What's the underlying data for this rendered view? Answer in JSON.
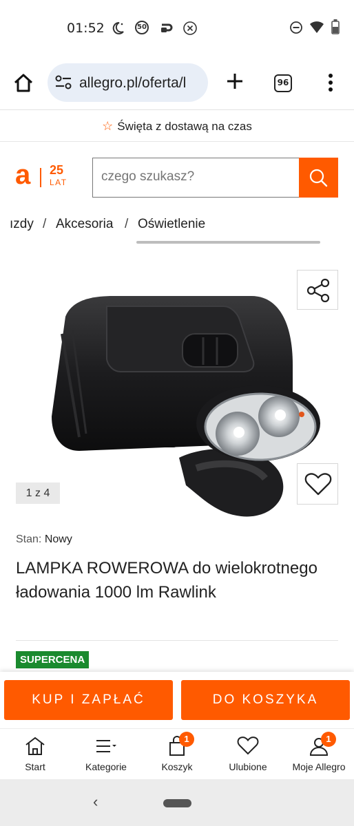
{
  "status_bar": {
    "time": "01:52",
    "icons": [
      "moon-alarm-icon",
      "speed-50-icon",
      "sync-icon",
      "close-circle-icon",
      "dnd-icon",
      "wifi-icon",
      "battery-icon"
    ],
    "speed_label": "50"
  },
  "browser": {
    "url": "allegro.pl/oferta/l",
    "tab_count": "96"
  },
  "promo": {
    "text": "Święta z dostawą na czas"
  },
  "logo": {
    "letter": "a",
    "years": "25",
    "suffix": "LAT"
  },
  "search": {
    "placeholder": "czego szukasz?"
  },
  "breadcrumb": {
    "items": [
      "ızdy",
      "Akcesoria",
      "Oświetlenie"
    ],
    "separator": "/"
  },
  "gallery": {
    "counter": "1 z 4"
  },
  "product": {
    "condition_label": "Stan:",
    "condition_value": "Nowy",
    "title": "LAMPKA ROWEROWA do wielokrotnego ładowania 1000 lm Rawlink",
    "badge": "SUPERCENA"
  },
  "actions": {
    "buy_now": "KUP I ZAPŁAĆ",
    "add_to_cart": "DO KOSZYKA"
  },
  "bottom_nav": [
    {
      "label": "Start",
      "icon": "home-icon",
      "badge": ""
    },
    {
      "label": "Kategorie",
      "icon": "menu-list-icon",
      "badge": ""
    },
    {
      "label": "Koszyk",
      "icon": "cart-bag-icon",
      "badge": "1"
    },
    {
      "label": "Ulubione",
      "icon": "heart-icon",
      "badge": ""
    },
    {
      "label": "Moje Allegro",
      "icon": "user-icon",
      "badge": "1"
    }
  ],
  "colors": {
    "brand": "#ff5a00",
    "supercena": "#1a8a2e",
    "url_pill": "#e8eef7"
  }
}
